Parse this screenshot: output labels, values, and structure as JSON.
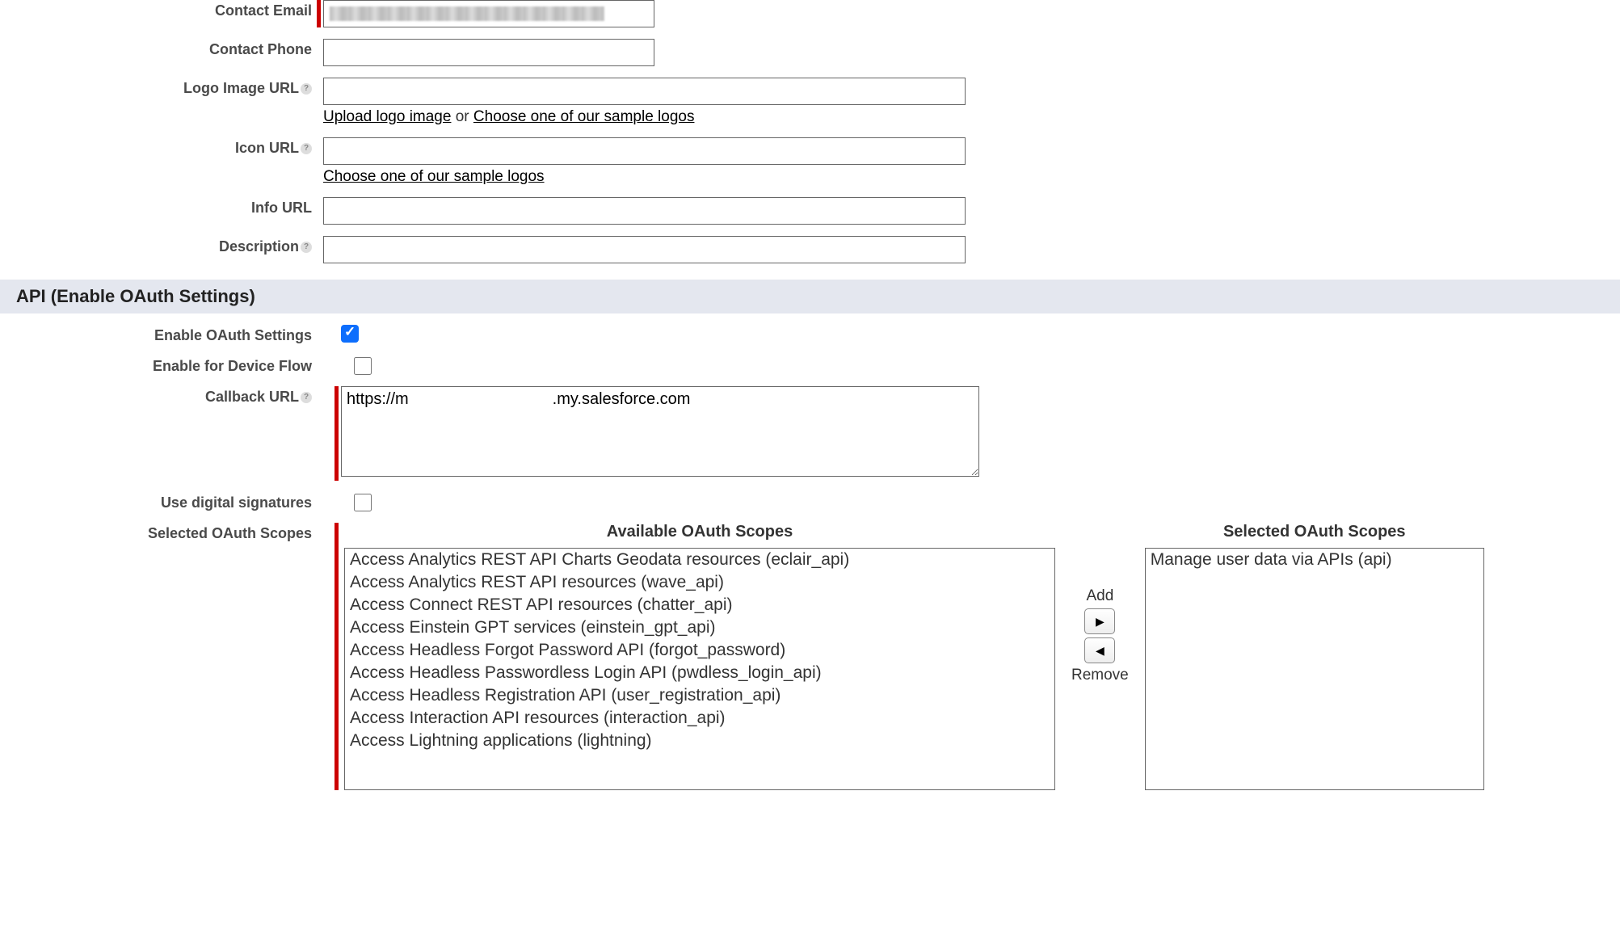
{
  "basicInfo": {
    "contactEmail": {
      "label": "Contact Email",
      "value": ""
    },
    "contactPhone": {
      "label": "Contact Phone",
      "value": ""
    },
    "logoImageUrl": {
      "label": "Logo Image URL",
      "value": "",
      "uploadLink": "Upload logo image",
      "orText": " or ",
      "sampleLink": "Choose one of our sample logos"
    },
    "iconUrl": {
      "label": "Icon URL",
      "value": "",
      "sampleLink": "Choose one of our sample logos"
    },
    "infoUrl": {
      "label": "Info URL",
      "value": ""
    },
    "description": {
      "label": "Description",
      "value": ""
    }
  },
  "apiSection": {
    "header": "API (Enable OAuth Settings)",
    "enableOAuth": {
      "label": "Enable OAuth Settings",
      "checked": true
    },
    "enableDeviceFlow": {
      "label": "Enable for Device Flow",
      "checked": false
    },
    "callbackUrl": {
      "label": "Callback URL",
      "valuePrefix": "https://m",
      "valueSuffix": ".my.salesforce.com"
    },
    "useDigitalSignatures": {
      "label": "Use digital signatures",
      "checked": false
    },
    "selectedScopes": {
      "label": "Selected OAuth Scopes",
      "availableHeader": "Available OAuth Scopes",
      "selectedHeader": "Selected OAuth Scopes",
      "addLabel": "Add",
      "removeLabel": "Remove",
      "available": [
        "Access Analytics REST API Charts Geodata resources (eclair_api)",
        "Access Analytics REST API resources (wave_api)",
        "Access Connect REST API resources (chatter_api)",
        "Access Einstein GPT services (einstein_gpt_api)",
        "Access Headless Forgot Password API (forgot_password)",
        "Access Headless Passwordless Login API (pwdless_login_api)",
        "Access Headless Registration API (user_registration_api)",
        "Access Interaction API resources (interaction_api)",
        "Access Lightning applications (lightning)"
      ],
      "selected": [
        "Manage user data via APIs (api)"
      ]
    }
  }
}
